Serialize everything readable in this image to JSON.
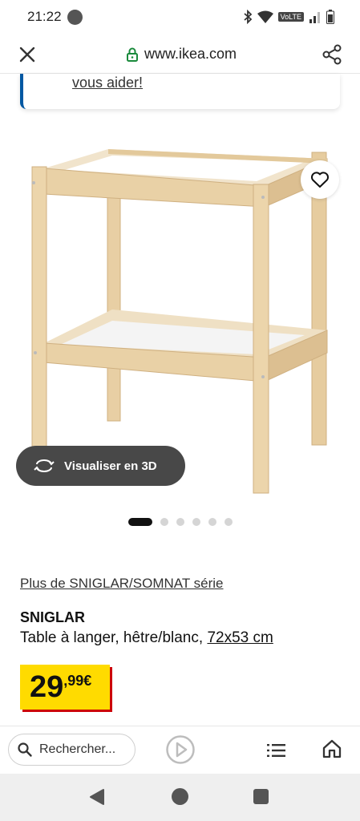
{
  "status_bar": {
    "time": "21:22",
    "network_label": "VoLTE"
  },
  "browser": {
    "url": "www.ikea.com",
    "close_icon": "close-icon",
    "lock_icon": "lock-icon",
    "share_icon": "share-icon"
  },
  "help_card": {
    "link_text": "vous aider!"
  },
  "product": {
    "view_3d_label": "Visualiser en 3D",
    "image_count": 6,
    "active_image": 1,
    "series_link": "Plus de SNIGLAR/SOMNAT série",
    "name": "SNIGLAR",
    "description": "Table à langer, hêtre/blanc, ",
    "dimensions": "72x53 cm",
    "price_integer": "29",
    "price_decimal": ",99€"
  },
  "toolbar": {
    "search_placeholder": "Rechercher..."
  },
  "colors": {
    "ikea_blue": "#0058a3",
    "price_yellow": "#ffdb00",
    "price_red": "#cc0008",
    "button_dark": "#484848"
  }
}
